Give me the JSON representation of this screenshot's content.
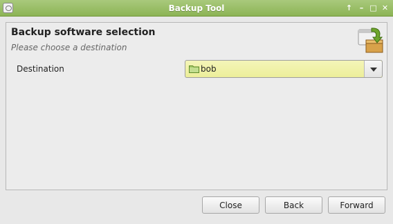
{
  "window": {
    "title": "Backup Tool",
    "controls": [
      "up-arrow-icon",
      "minimize-icon",
      "maximize-icon",
      "close-icon"
    ]
  },
  "page": {
    "title": "Backup software selection",
    "subtitle": "Please choose a destination",
    "header_icon": "package-icon"
  },
  "form": {
    "destination_label": "Destination",
    "destination_value": "bob",
    "destination_icon": "folder-icon"
  },
  "buttons": {
    "close": "Close",
    "back": "Back",
    "forward": "Forward"
  },
  "colors": {
    "titlebar": "#8cb455",
    "combo_background": "#ecee9a"
  }
}
